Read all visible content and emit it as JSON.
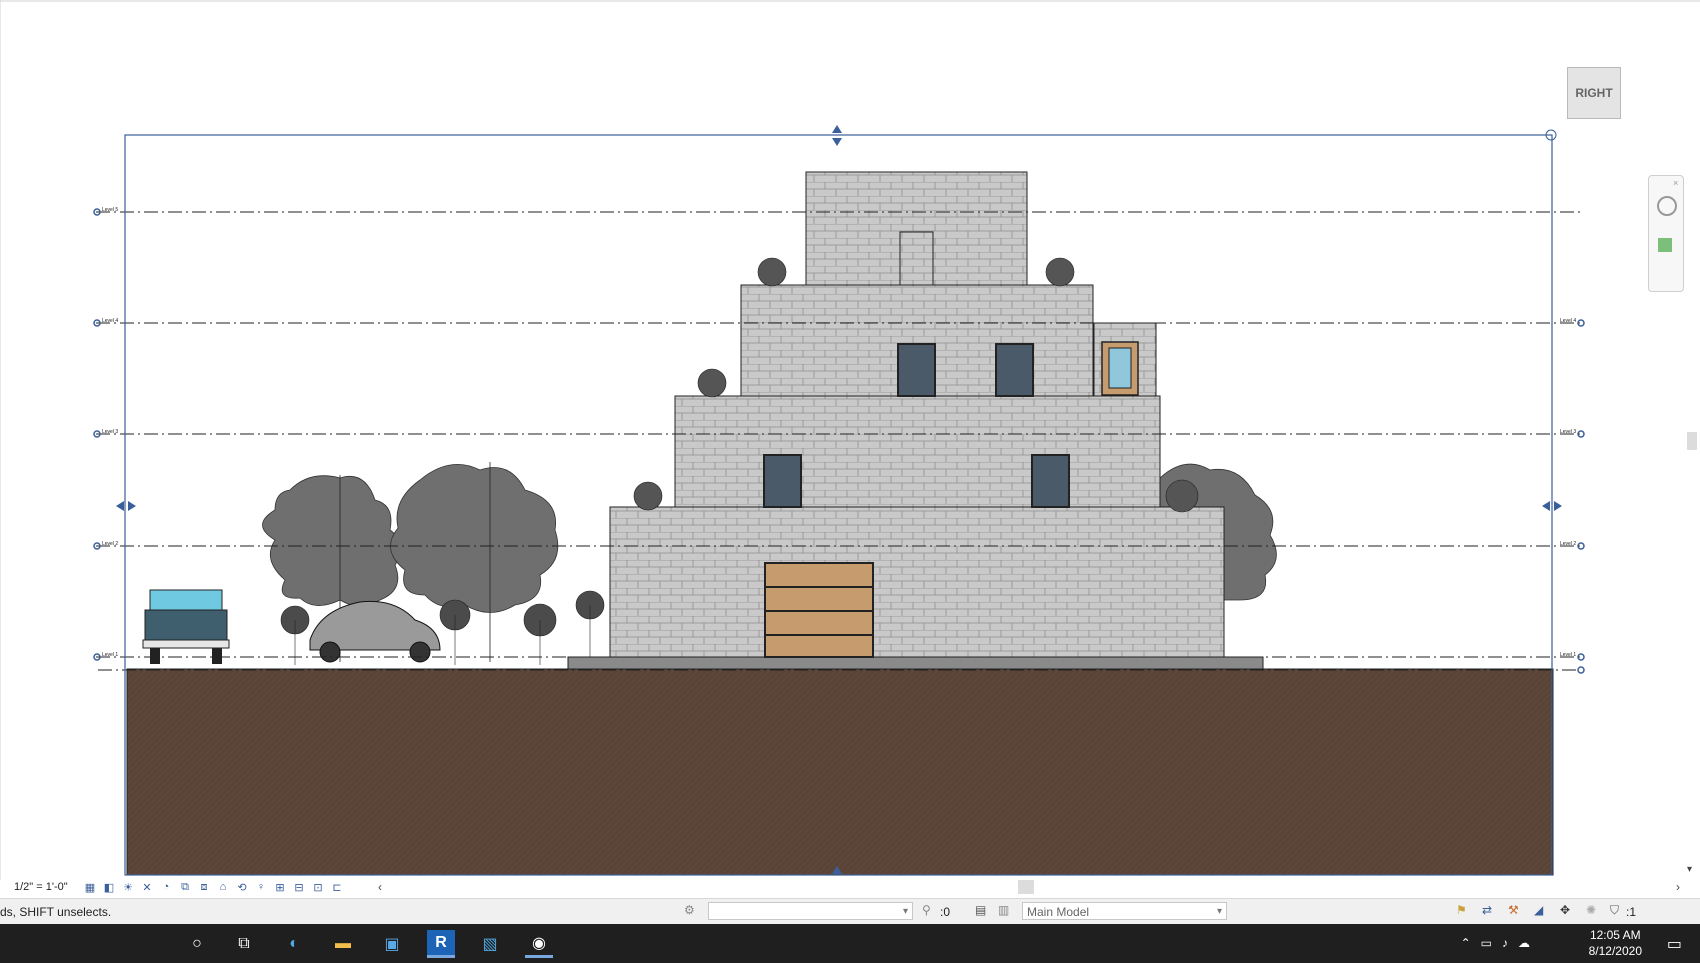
{
  "view": {
    "scale": "1/2\" = 1'-0\"",
    "viewcube_label": "RIGHT"
  },
  "levels": [
    {
      "name": "Level 5"
    },
    {
      "name": "Level 4"
    },
    {
      "name": "Level 3"
    },
    {
      "name": "Level 2"
    },
    {
      "name": "Level 1"
    }
  ],
  "status": {
    "hint": "ds, SHIFT unselects.",
    "workset_value": "",
    "design_option_count": ":0",
    "model_selector": "Main Model",
    "filter_count": ":1"
  },
  "taskbar": {
    "time": "12:05 AM",
    "date": "8/12/2020"
  },
  "colors": {
    "brick": "#c9c9c9",
    "ground": "#5a4438",
    "window": "#4b5a68",
    "garage": "#c69b6d",
    "tree": "#6f6f6f",
    "crop_box": "#3a5f9a",
    "taskbar": "#1f1f1f"
  }
}
